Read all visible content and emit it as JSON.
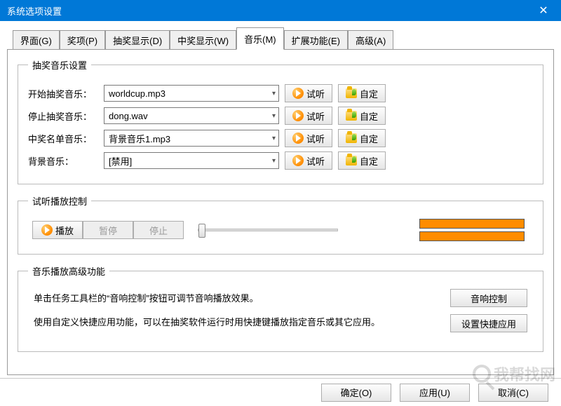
{
  "window": {
    "title": "系统选项设置"
  },
  "tabs": [
    {
      "label": "界面(G)"
    },
    {
      "label": "奖项(P)"
    },
    {
      "label": "抽奖显示(D)"
    },
    {
      "label": "中奖显示(W)"
    },
    {
      "label": "音乐(M)"
    },
    {
      "label": "扩展功能(E)"
    },
    {
      "label": "高级(A)"
    }
  ],
  "group1": {
    "legend": "抽奖音乐设置",
    "rows": [
      {
        "label": "开始抽奖音乐：",
        "value": "worldcup.mp3"
      },
      {
        "label": "停止抽奖音乐：",
        "value": "dong.wav"
      },
      {
        "label": "中奖名单音乐：",
        "value": "背景音乐1.mp3"
      },
      {
        "label": "背景音乐：",
        "value": "[禁用]"
      }
    ],
    "preview": "试听",
    "custom": "自定"
  },
  "group2": {
    "legend": "试听播放控制",
    "play": "播放",
    "pause": "暂停",
    "stop": "停止"
  },
  "group3": {
    "legend": "音乐播放高级功能",
    "line1": "单击任务工具栏的“音响控制”按钮可调节音响播放效果。",
    "line2": "使用自定义快捷应用功能，可以在抽奖软件运行时用快捷键播放指定音乐或其它应用。",
    "btn_sound": "音响控制",
    "btn_shortcut": "设置快捷应用"
  },
  "footer": {
    "ok": "确定(O)",
    "apply": "应用(U)",
    "cancel": "取消(C)"
  },
  "watermark": "我帮找网"
}
